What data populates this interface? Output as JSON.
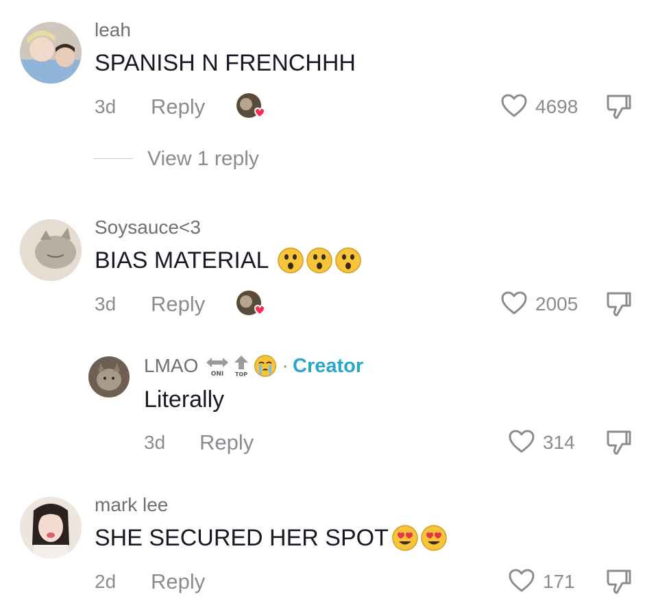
{
  "comments": [
    {
      "username": "leah",
      "text": "SPANISH N FRENCHHH",
      "time": "3d",
      "reply_label": "Reply",
      "likes": "4698",
      "view_replies": "View 1 reply"
    },
    {
      "username": "Soysauce<3",
      "text": "BIAS MATERIAL",
      "emoji": [
        "astonished-emoji",
        "astonished-emoji",
        "astonished-emoji"
      ],
      "time": "3d",
      "reply_label": "Reply",
      "likes": "2005"
    },
    {
      "username": "LMAO",
      "badges": [
        "ONI",
        "TOP"
      ],
      "creator_label": "Creator",
      "separator": "·",
      "text": "Literally",
      "time": "3d",
      "reply_label": "Reply",
      "likes": "314"
    },
    {
      "username": "mark lee",
      "text": "SHE SECURED HER SPOT",
      "emoji": [
        "heart-eyes-emoji",
        "heart-eyes-emoji"
      ],
      "time": "2d",
      "reply_label": "Reply",
      "likes": "171"
    }
  ],
  "colors": {
    "text": "#161823",
    "muted": "#8a8b91",
    "creator": "#2ba6c8",
    "heart_badge": "#fe2c55"
  }
}
